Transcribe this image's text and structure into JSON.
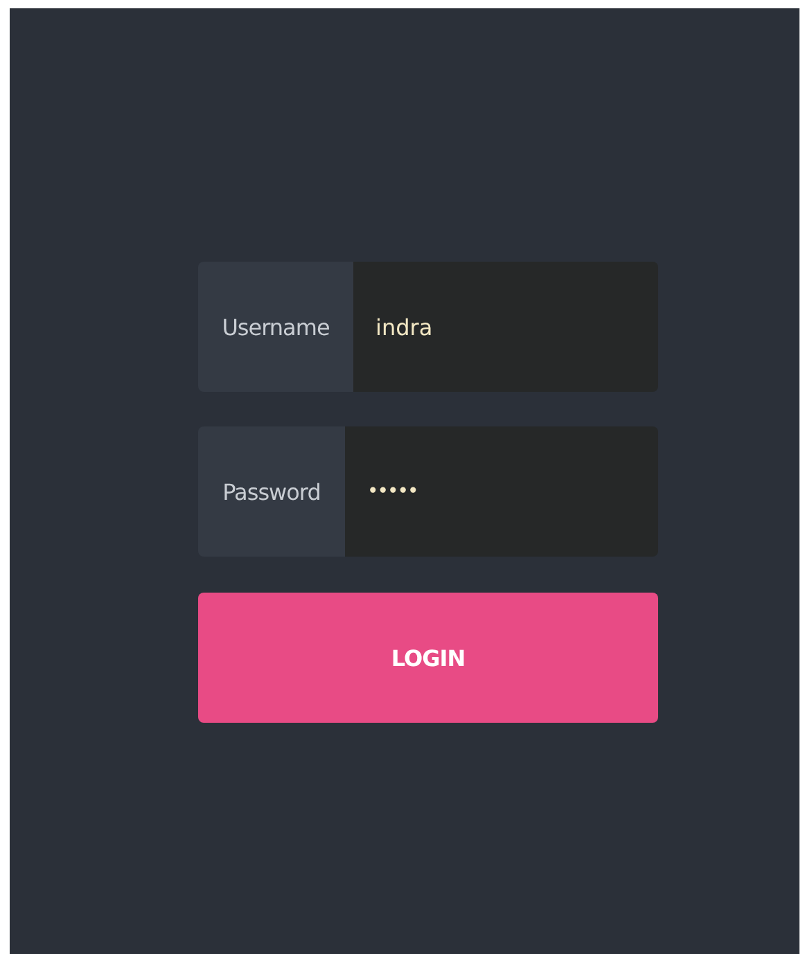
{
  "fields": [
    {
      "kind": "text",
      "label": "Username",
      "value": "indra"
    },
    {
      "kind": "password",
      "label": "Password",
      "value": "•••••"
    }
  ],
  "button": {
    "label": "LOGIN"
  }
}
